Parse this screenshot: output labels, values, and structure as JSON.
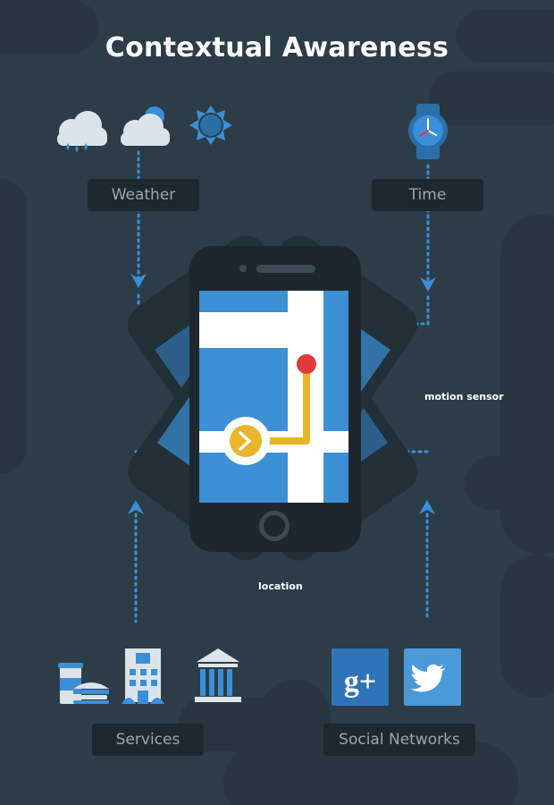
{
  "title": "Contextual Awareness",
  "labels": {
    "weather": "Weather",
    "time": "Time",
    "services": "Services",
    "social_networks": "Social Networks"
  },
  "captions": {
    "motion_sensor": "motion sensor",
    "location": "location"
  },
  "icons": {
    "weather": [
      "rain-cloud-icon",
      "partly-sunny-icon",
      "sun-icon"
    ],
    "time": [
      "watch-icon"
    ],
    "services": [
      "coffee-burger-icon",
      "hotel-icon",
      "museum-icon"
    ],
    "social": [
      "google-plus-icon",
      "twitter-icon"
    ]
  },
  "colors": {
    "background": "#2c3d47",
    "accent_blue": "#3d8fd6",
    "phone_body": "#1d272d",
    "route_yellow": "#e8b62a",
    "pin_red": "#e03a3a",
    "arrow_blue": "#3b8fd9"
  }
}
